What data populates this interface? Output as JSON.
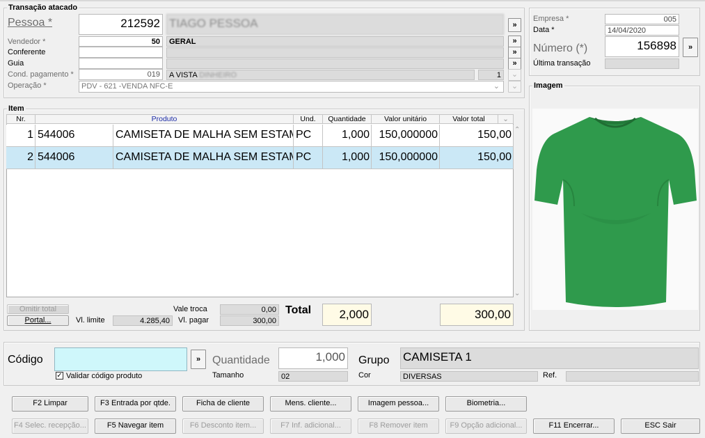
{
  "transacao": {
    "legend": "Transação atacado",
    "pessoa_label": "Pessoa *",
    "pessoa_code": "212592",
    "pessoa_name": "TIAGO PESSOA",
    "vendedor_label": "Vendedor *",
    "vendedor_code": "50",
    "vendedor_name": "GERAL",
    "conferente_label": "Conferente",
    "guia_label": "Guia",
    "cond_label": "Cond. pagamento *",
    "cond_code": "019",
    "cond_name": "A VISTA",
    "cond_blur": "DINHEIRO",
    "cond_num": "1",
    "operacao_label": "Operação *",
    "operacao_value": "PDV - 621 -VENDA NFC-E",
    "more": "»"
  },
  "empresa": {
    "empresa_label": "Empresa *",
    "empresa_value": "005",
    "data_label": "Data *",
    "data_value": "14/04/2020",
    "numero_label": "Número (*)",
    "numero_value": "156898",
    "ultima_label": "Última transação"
  },
  "imagem": {
    "legend": "Imagem"
  },
  "item": {
    "legend": "Item",
    "columns": [
      "Nr.",
      "Produto",
      "Und.",
      "Quantidade",
      "Valor unitário",
      "Valor total"
    ],
    "rows": [
      {
        "nr": "1",
        "codigo": "544006",
        "produto": "CAMISETA DE MALHA SEM ESTAMPA",
        "und": "PC",
        "qtd": "1,000",
        "unit": "150,000000",
        "total": "150,00"
      },
      {
        "nr": "2",
        "codigo": "544006",
        "produto": "CAMISETA DE MALHA SEM ESTAMPA",
        "und": "PC",
        "qtd": "1,000",
        "unit": "150,000000",
        "total": "150,00"
      }
    ],
    "omitir_label": "Omitir total",
    "portal_label": "Portal...",
    "vl_limite_label": "Vl. limite",
    "vl_limite_value": "4.285,40",
    "vale_troca_label": "Vale troca",
    "vale_troca_value": "0,00",
    "vl_pagar_label": "Vl. pagar",
    "vl_pagar_value": "300,00",
    "total_label": "Total",
    "total_qtd": "2,000",
    "total_valor": "300,00"
  },
  "codigo": {
    "codigo_label": "Código",
    "codigo_value": "",
    "validar_label": "Validar código produto",
    "quantidade_label": "Quantidade",
    "quantidade_value": "1,000",
    "tamanho_label": "Tamanho",
    "tamanho_value": "02",
    "grupo_label": "Grupo",
    "grupo_value": "CAMISETA 1",
    "cor_label": "Cor",
    "cor_value": "DIVERSAS",
    "ref_label": "Ref.",
    "ref_value": ""
  },
  "buttons": {
    "f2": "F2 Limpar",
    "f3": "F3 Entrada por qtde.",
    "ficha": "Ficha de cliente",
    "mens": "Mens. cliente...",
    "imagem": "Imagem pessoa...",
    "biometria": "Biometria...",
    "f4": "F4 Selec. recepção...",
    "f5": "F5 Navegar item",
    "f6": "F6 Desconto item...",
    "f7": "F7 Inf. adicional...",
    "f8": "F8 Remover item",
    "f9": "F9 Opção adicional...",
    "f11": "F11 Encerrar...",
    "esc": "ESC Sair"
  },
  "colors": {
    "selected_row": "#cbe8f6",
    "codigo_input": "#cff7fb",
    "total_bg": "#fffbe6",
    "shirt_green": "#2f9a4c"
  }
}
